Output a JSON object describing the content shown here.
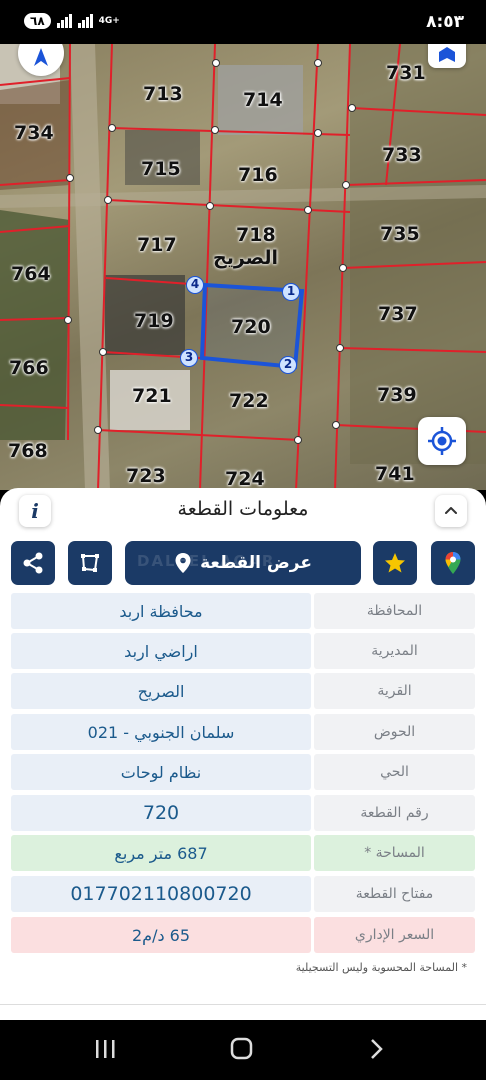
{
  "status_bar": {
    "time": "٨:٥٣",
    "battery": "٦٨",
    "network": "4G+"
  },
  "map": {
    "parcels": [
      {
        "id": "731"
      },
      {
        "id": "713"
      },
      {
        "id": "714"
      },
      {
        "id": "734"
      },
      {
        "id": "733"
      },
      {
        "id": "715"
      },
      {
        "id": "716"
      },
      {
        "id": "717"
      },
      {
        "id": "718"
      },
      {
        "id": "735"
      },
      {
        "id": "764"
      },
      {
        "id": "737"
      },
      {
        "id": "719"
      },
      {
        "id": "720"
      },
      {
        "id": "766"
      },
      {
        "id": "721"
      },
      {
        "id": "722"
      },
      {
        "id": "739"
      },
      {
        "id": "768"
      },
      {
        "id": "723"
      },
      {
        "id": "724"
      },
      {
        "id": "741"
      }
    ],
    "street_label": "الصريح",
    "vertices": [
      "1",
      "2",
      "3",
      "4"
    ],
    "colors": {
      "parcel_lines": "#e0202a",
      "selected_outline": "#1b54d8"
    }
  },
  "sheet": {
    "title": "معلومات القطعة",
    "info_icon": "i",
    "view_button_label": "عرض القطعة",
    "watermark": "DALEEL AQAR",
    "fields": [
      {
        "label": "المحافظة",
        "value": "محافظة اربد"
      },
      {
        "label": "المديرية",
        "value": "اراضي اربد"
      },
      {
        "label": "القرية",
        "value": "الصريح"
      },
      {
        "label": "الحوض",
        "value": "سلمان الجنوبي - 021"
      },
      {
        "label": "الحي",
        "value": "نظام لوحات"
      },
      {
        "label": "رقم القطعة",
        "value": "720"
      },
      {
        "label": "المساحة *",
        "value": "687  متر مربع"
      },
      {
        "label": "مفتاح القطعة",
        "value": "017702110800720"
      },
      {
        "label": "السعر الإداري",
        "value": "65 د/م2"
      }
    ],
    "footnote": "* المساحة المحسوبة وليس التسجيلية"
  },
  "colors": {
    "primary": "#1b3a66",
    "area_bg": "#dcf1dd",
    "price_bg": "#fbdfe0",
    "value_text": "#1b5a8c"
  }
}
